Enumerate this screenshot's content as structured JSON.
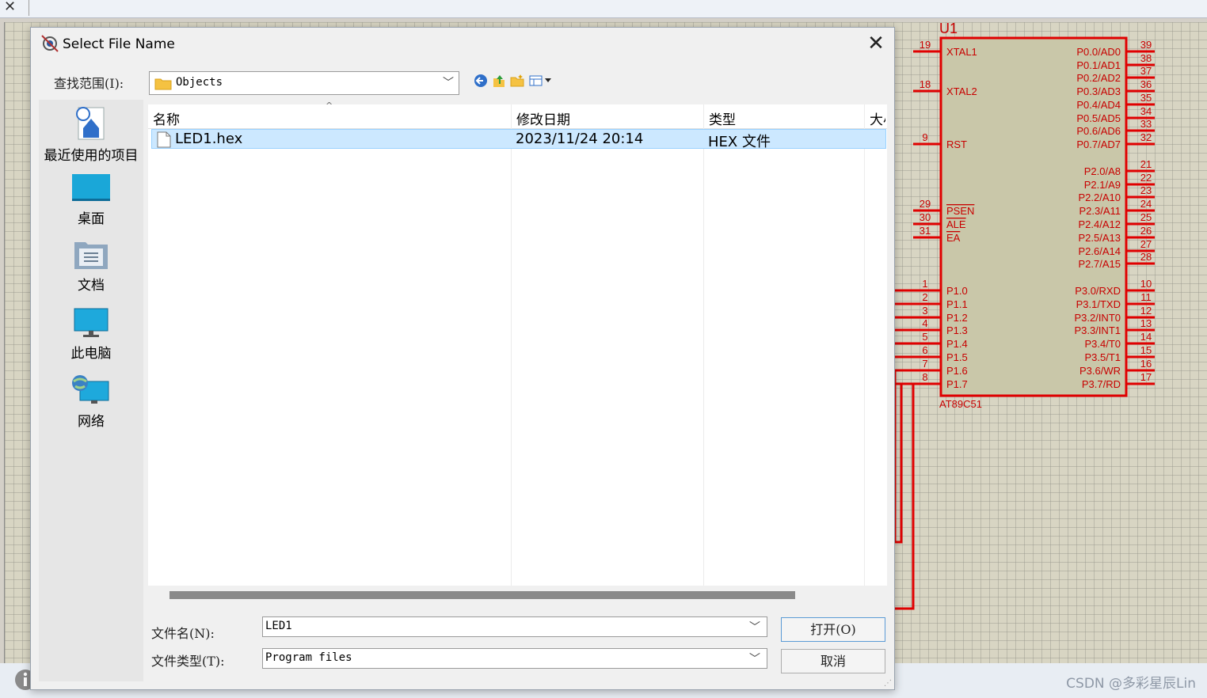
{
  "dialog": {
    "title": "Select File Name",
    "lookin_label": "查找范围(I):",
    "lookin_value": "Objects",
    "places": [
      {
        "label": "最近使用的项目",
        "icon": "recent-items-icon"
      },
      {
        "label": "桌面",
        "icon": "desktop-icon"
      },
      {
        "label": "文档",
        "icon": "documents-icon"
      },
      {
        "label": "此电脑",
        "icon": "this-pc-icon"
      },
      {
        "label": "网络",
        "icon": "network-icon"
      }
    ],
    "columns": [
      "名称",
      "修改日期",
      "类型",
      "大小"
    ],
    "files": [
      {
        "name": "LED1.hex",
        "modified": "2023/11/24 20:14",
        "type": "HEX 文件",
        "size": ""
      }
    ],
    "filename_label": "文件名(N):",
    "filename_value": "LED1",
    "filetype_label": "文件类型(T):",
    "filetype_value": "Program files",
    "open_button": "打开(O)",
    "cancel_button": "取消"
  },
  "chip": {
    "ref": "U1",
    "part": "AT89C51",
    "left_pins": [
      {
        "num": "19",
        "name": "XTAL1"
      },
      {
        "num": "18",
        "name": "XTAL2"
      },
      {
        "num": "9",
        "name": "RST"
      },
      {
        "num": "29",
        "name": "PSEN"
      },
      {
        "num": "30",
        "name": "ALE"
      },
      {
        "num": "31",
        "name": "EA"
      },
      {
        "num": "1",
        "name": "P1.0"
      },
      {
        "num": "2",
        "name": "P1.1"
      },
      {
        "num": "3",
        "name": "P1.2"
      },
      {
        "num": "4",
        "name": "P1.3"
      },
      {
        "num": "5",
        "name": "P1.4"
      },
      {
        "num": "6",
        "name": "P1.5"
      },
      {
        "num": "7",
        "name": "P1.6"
      },
      {
        "num": "8",
        "name": "P1.7"
      }
    ],
    "right_pins": [
      {
        "num": "39",
        "name": "P0.0/AD0"
      },
      {
        "num": "38",
        "name": "P0.1/AD1"
      },
      {
        "num": "37",
        "name": "P0.2/AD2"
      },
      {
        "num": "36",
        "name": "P0.3/AD3"
      },
      {
        "num": "35",
        "name": "P0.4/AD4"
      },
      {
        "num": "34",
        "name": "P0.5/AD5"
      },
      {
        "num": "33",
        "name": "P0.6/AD6"
      },
      {
        "num": "32",
        "name": "P0.7/AD7"
      },
      {
        "num": "21",
        "name": "P2.0/A8"
      },
      {
        "num": "22",
        "name": "P2.1/A9"
      },
      {
        "num": "23",
        "name": "P2.2/A10"
      },
      {
        "num": "24",
        "name": "P2.3/A11"
      },
      {
        "num": "25",
        "name": "P2.4/A12"
      },
      {
        "num": "26",
        "name": "P2.5/A13"
      },
      {
        "num": "27",
        "name": "P2.6/A14"
      },
      {
        "num": "28",
        "name": "P2.7/A15"
      },
      {
        "num": "10",
        "name": "P3.0/RXD"
      },
      {
        "num": "11",
        "name": "P3.1/TXD"
      },
      {
        "num": "12",
        "name": "P3.2/INT0"
      },
      {
        "num": "13",
        "name": "P3.3/INT1"
      },
      {
        "num": "14",
        "name": "P3.4/T0"
      },
      {
        "num": "15",
        "name": "P3.5/T1"
      },
      {
        "num": "16",
        "name": "P3.6/WR"
      },
      {
        "num": "17",
        "name": "P3.7/RD"
      }
    ],
    "color": "#e00000",
    "body_fill": "#c9c7a9"
  },
  "watermark": "CSDN @多彩星辰Lin"
}
